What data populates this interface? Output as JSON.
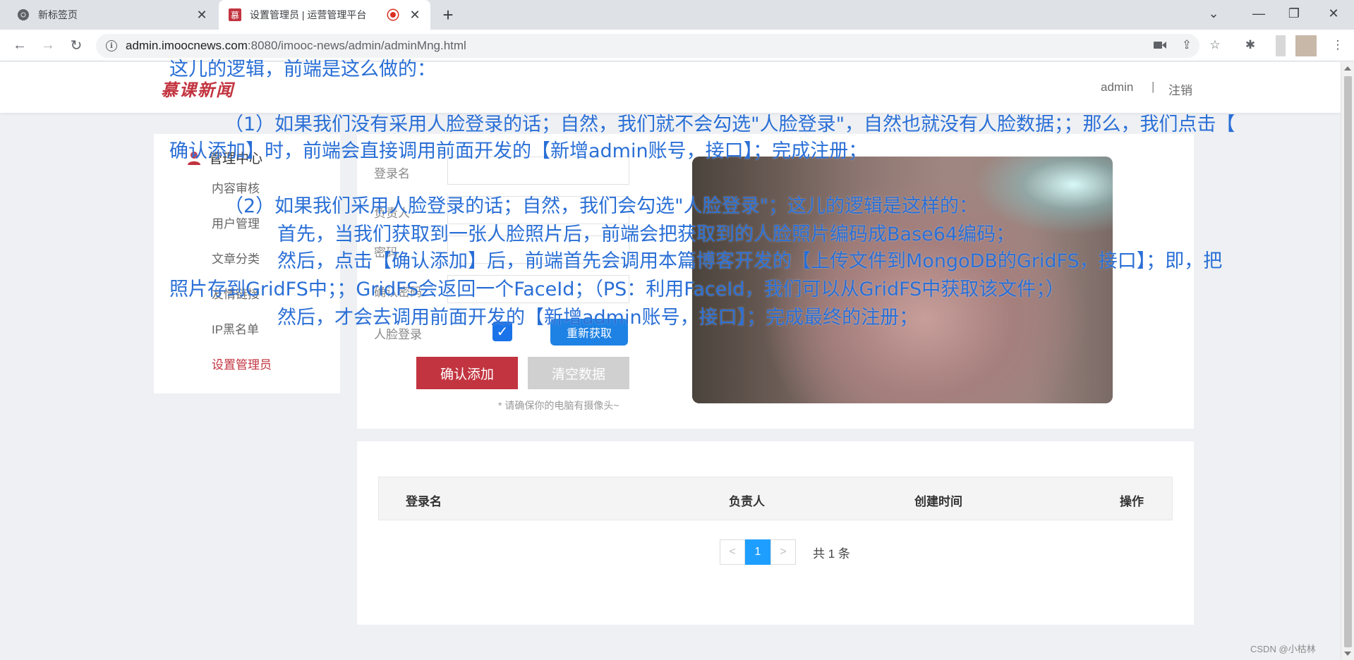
{
  "browser": {
    "tabs": [
      {
        "title": "新标签页",
        "active": false
      },
      {
        "title": "设置管理员 | 运营管理平台",
        "active": true
      }
    ],
    "url_host": "admin.imoocnews.com",
    "url_path": ":8080/imooc-news/admin/adminMng.html"
  },
  "header": {
    "logo": "慕课新闻",
    "user": "admin",
    "separator": "|",
    "logout": "注销"
  },
  "sidebar": {
    "title": "管理中心",
    "items": [
      {
        "label": "内容审核",
        "active": false
      },
      {
        "label": "用户管理",
        "active": false
      },
      {
        "label": "文章分类",
        "active": false
      },
      {
        "label": "友情链接",
        "active": false
      },
      {
        "label": "IP黑名单",
        "active": false
      },
      {
        "label": "设置管理员",
        "active": true
      }
    ]
  },
  "form": {
    "labels": {
      "username": "登录名",
      "owner": "负责人",
      "password": "密码",
      "confirm_password": "确认密码",
      "face_login": "人脸登录"
    },
    "face_login_checked": true,
    "refetch_button": "重新获取",
    "confirm_button": "确认添加",
    "clear_button": "清空数据",
    "note": "* 请确保你的电脑有摄像头~"
  },
  "table": {
    "columns": [
      "登录名",
      "负责人",
      "创建时间",
      "操作"
    ],
    "pagination": {
      "prev": "<",
      "current": "1",
      "next": ">",
      "total": "共 1 条"
    }
  },
  "annotation": {
    "line1": "这儿的逻辑，前端是这么做的：",
    "line2": "（1）如果我们没有采用人脸登录的话；自然，我们就不会勾选\"人脸登录\"，自然也就没有人脸数据；；那么，我们点击【",
    "line3": "确认添加】时，前端会直接调用前面开发的【新增admin账号，接口】；完成注册；",
    "line4": "（2）如果我们采用人脸登录的话；自然，我们会勾选\"人脸登录\"；这儿的逻辑是这样的：",
    "line5": "首先，当我们获取到一张人脸照片后，前端会把获取到的人脸照片编码成Base64编码；",
    "line6": "然后，点击【确认添加】后，前端首先会调用本篇博客开发的【上传文件到MongoDB的GridFS，接口】；即，把",
    "line7": "照片存到GridFS中；；GridFS会返回一个FaceId；（PS：利用FaceId，我们可以从GridFS中获取该文件；）",
    "line8": "然后，才会去调用前面开发的【新增admin账号，接口】；完成最终的注册；"
  },
  "watermark": "CSDN @小枯林",
  "colors": {
    "brand_red": "#c23440",
    "primary_blue": "#1e82e4",
    "annotation_blue": "#2a6fd6"
  }
}
